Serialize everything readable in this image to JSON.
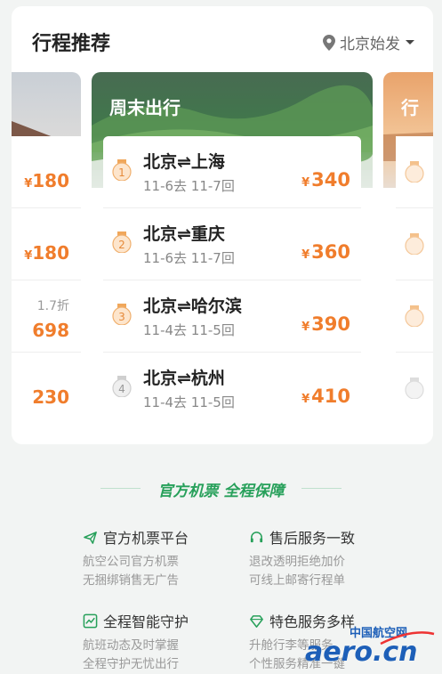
{
  "header": {
    "title": "行程推荐",
    "city": "北京始发"
  },
  "panels": {
    "center": {
      "label": "周末出行",
      "routes": [
        {
          "rank": "1",
          "route": "北京⇌上海",
          "dates": "11-6去  11-7回",
          "yen": "¥",
          "price": "340"
        },
        {
          "rank": "2",
          "route": "北京⇌重庆",
          "dates": "11-6去  11-7回",
          "yen": "¥",
          "price": "360"
        },
        {
          "rank": "3",
          "route": "北京⇌哈尔滨",
          "dates": "11-4去  11-5回",
          "yen": "¥",
          "price": "390"
        },
        {
          "rank": "4",
          "route": "北京⇌杭州",
          "dates": "11-4去  11-5回",
          "yen": "¥",
          "price": "410"
        }
      ]
    },
    "left": {
      "prices": [
        "180",
        "180",
        "698",
        "230"
      ],
      "yen": "¥",
      "discount": "1.7折"
    },
    "right": {
      "label_partial": "行"
    }
  },
  "slogan": "官方机票 全程保障",
  "features": [
    {
      "icon": "plane-icon",
      "title": "官方机票平台",
      "desc1": "航空公司官方机票",
      "desc2": "无捆绑销售无广告"
    },
    {
      "icon": "headset-icon",
      "title": "售后服务一致",
      "desc1": "退改透明拒绝加价",
      "desc2": "可线上邮寄行程单"
    },
    {
      "icon": "chart-icon",
      "title": "全程智能守护",
      "desc1": "航班动态及时掌握",
      "desc2": "全程守护无忧出行"
    },
    {
      "icon": "diamond-icon",
      "title": "特色服务多样",
      "desc1": "升舱行李等服务",
      "desc2": "个性服务精准一键"
    }
  ],
  "watermark": {
    "cn": "中国航空网",
    "domain": "aero.cn"
  },
  "colors": {
    "accent": "#f07d2c",
    "brand_green": "#27a05a"
  }
}
